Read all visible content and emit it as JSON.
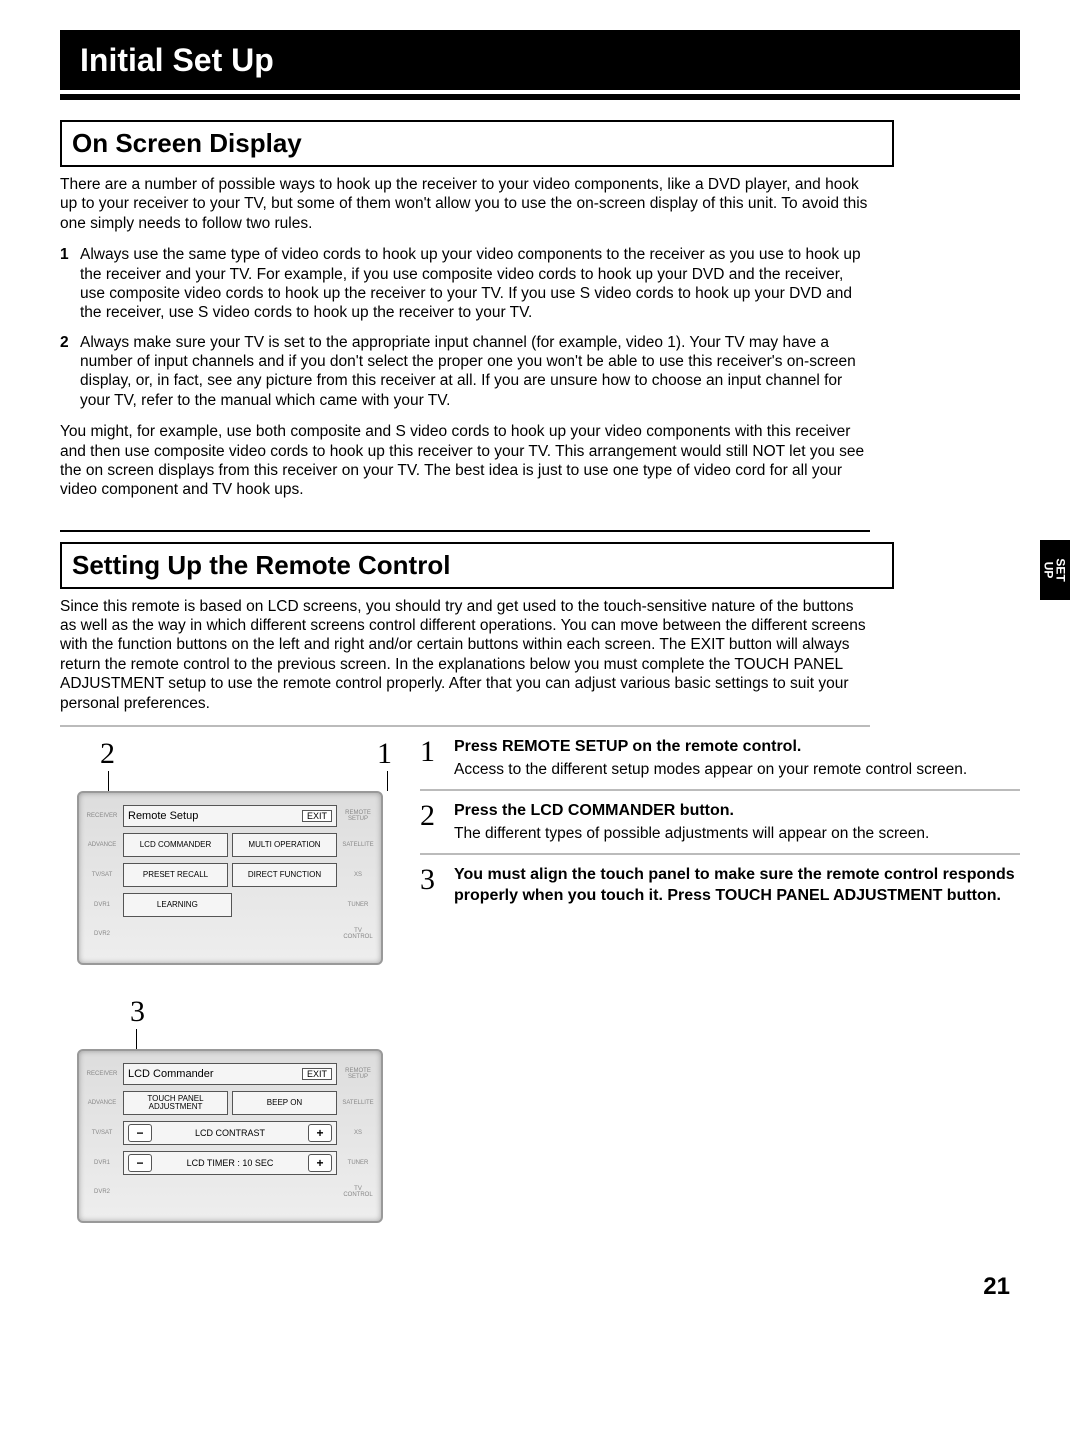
{
  "header": {
    "title": "Initial Set Up"
  },
  "side_tab": {
    "line1": "SET",
    "line2": "UP"
  },
  "section1": {
    "heading": "On Screen Display",
    "intro": "There are a number of possible ways to hook up the receiver to your video components, like a DVD player, and hook up to your receiver to your TV, but some of them won't allow you to use the on-screen display of this unit. To avoid this one simply needs to follow two rules.",
    "rules": [
      "Always use the same type of video cords to hook up your video components to the receiver as you use to hook up the receiver and your TV. For example, if you use composite video cords to hook up your DVD and the receiver, use composite video cords to hook up the receiver to your TV. If you use S video cords to hook up your DVD and the receiver, use S video cords to hook up the receiver to your TV.",
      "Always make sure your TV is set to the appropriate input channel (for example, video 1). Your TV may have a number of input channels and if you don't select the proper one you won't be able to use this receiver's on-screen display, or, in fact, see any picture from this receiver at all. If you are unsure how to choose an input channel for your TV, refer to the manual which came with your TV."
    ],
    "outro": "You might, for example, use both composite and S video cords to hook up your video components with this receiver and then use composite video cords to hook up this receiver to your TV. This arrangement would still NOT let you see the on screen displays from this receiver on your TV. The best idea is just to use one type of video cord for all your video component and TV hook ups."
  },
  "section2": {
    "heading": "Setting Up the Remote Control",
    "intro": "Since this remote is based on LCD screens, you should try and get used to the touch-sensitive nature of the buttons as well as the way in which different screens control different operations. You can move between the different screens with the function buttons on the left and right and/or certain buttons within each screen. The EXIT button will always return the remote control to the previous screen. In the explanations below you must complete the TOUCH PANEL ADJUSTMENT setup to use the remote control properly. After that you can adjust various basic settings to suit your personal preferences.",
    "steps": [
      {
        "n": "1",
        "title": "Press REMOTE SETUP on the remote control.",
        "body": "Access to the different setup modes appear on your remote control screen."
      },
      {
        "n": "2",
        "title": "Press the LCD COMMANDER button.",
        "body": "The different types of possible adjustments will appear on the screen."
      },
      {
        "n": "3",
        "title": "You must align the touch panel to make sure the remote control responds properly when you touch it. Press TOUCH PANEL ADJUSTMENT button.",
        "body": ""
      }
    ],
    "callouts": {
      "top_left": "2",
      "top_right": "1",
      "mid": "3"
    }
  },
  "screen1": {
    "title": "Remote Setup",
    "exit": "EXIT",
    "side": [
      "RECEIVER",
      "REMOTE SETUP",
      "ADVANCE",
      "SATELLITE",
      "TV/SAT",
      "XS",
      "DVR1",
      "TUNER",
      "DVR2",
      "TV CONTROL"
    ],
    "buttons": {
      "lcd_commander": "LCD COMMANDER",
      "multi_operation": "MULTI OPERATION",
      "preset_recall": "PRESET RECALL",
      "direct_function": "DIRECT FUNCTION",
      "learning": "LEARNING"
    }
  },
  "screen2": {
    "title": "LCD Commander",
    "exit": "EXIT",
    "side": [
      "RECEIVER",
      "REMOTE SETUP",
      "ADVANCE",
      "SATELLITE",
      "TV/SAT",
      "XS",
      "DVR1",
      "TUNER",
      "DVR2",
      "TV CONTROL"
    ],
    "buttons": {
      "touch_panel": "TOUCH PANEL ADJUSTMENT",
      "beep_on": "BEEP ON",
      "lcd_contrast": "LCD CONTRAST",
      "lcd_timer": "LCD TIMER : 10 SEC"
    }
  },
  "page_number": "21"
}
